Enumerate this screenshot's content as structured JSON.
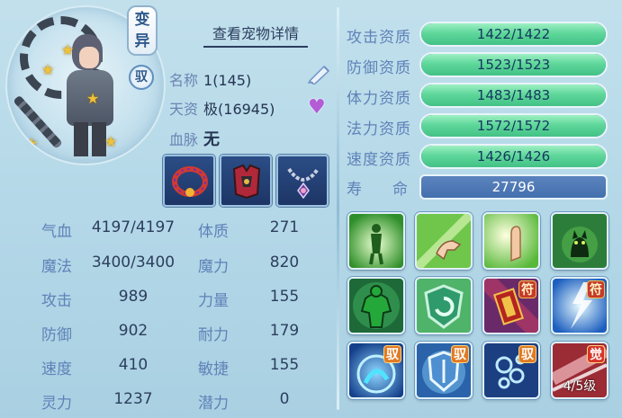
{
  "header": {
    "transform_badge": "变异",
    "ride_badge": "驭",
    "detail_link": "查看宠物详情"
  },
  "info": {
    "name_label": "名称",
    "name_value": "1(145)",
    "talent_label": "天资",
    "talent_value": "极(16945)",
    "blood_label": "血脉",
    "blood_value": "无"
  },
  "equipment": [
    {
      "name": "collar",
      "accent": "#d23a30"
    },
    {
      "name": "armor",
      "accent": "#b0283a"
    },
    {
      "name": "necklace",
      "accent": "#6b3fa3"
    }
  ],
  "stats": [
    {
      "label": "气血",
      "value": "4197/4197"
    },
    {
      "label": "魔法",
      "value": "3400/3400"
    },
    {
      "label": "攻击",
      "value": "989"
    },
    {
      "label": "防御",
      "value": "902"
    },
    {
      "label": "速度",
      "value": "410"
    },
    {
      "label": "灵力",
      "value": "1237"
    }
  ],
  "attributes": [
    {
      "label": "体质",
      "value": "271"
    },
    {
      "label": "魔力",
      "value": "820"
    },
    {
      "label": "力量",
      "value": "155"
    },
    {
      "label": "耐力",
      "value": "179"
    },
    {
      "label": "敏捷",
      "value": "155"
    },
    {
      "label": "潜力",
      "value": "0"
    }
  ],
  "aptitudes": [
    {
      "label": "攻击资质",
      "value": "1422/1422",
      "fill": 1.0
    },
    {
      "label": "防御资质",
      "value": "1523/1523",
      "fill": 1.0
    },
    {
      "label": "体力资质",
      "value": "1483/1483",
      "fill": 1.0
    },
    {
      "label": "法力资质",
      "value": "1572/1572",
      "fill": 1.0
    },
    {
      "label": "速度资质",
      "value": "1426/1426",
      "fill": 1.0
    }
  ],
  "lifespan": {
    "label_a": "寿",
    "label_b": "命",
    "value": "27796"
  },
  "skills": [
    {
      "name": "skill-figure-icon",
      "tag": "",
      "level": ""
    },
    {
      "name": "skill-strike-hand-icon",
      "tag": "",
      "level": ""
    },
    {
      "name": "skill-palm-icon",
      "tag": "",
      "level": ""
    },
    {
      "name": "skill-cat-icon",
      "tag": "",
      "level": ""
    },
    {
      "name": "skill-muscle-icon",
      "tag": "",
      "level": ""
    },
    {
      "name": "skill-shield-icon",
      "tag": "",
      "level": ""
    },
    {
      "name": "skill-talisman-scroll-icon",
      "tag": "符",
      "level": ""
    },
    {
      "name": "skill-lightning-icon",
      "tag": "符",
      "level": ""
    },
    {
      "name": "skill-water-rider-icon",
      "tag": "驭",
      "level": ""
    },
    {
      "name": "skill-guard-shield-icon",
      "tag": "驭",
      "level": ""
    },
    {
      "name": "skill-bubbles-icon",
      "tag": "驭",
      "level": ""
    },
    {
      "name": "skill-awaken-icon",
      "tag": "觉",
      "level": "4/5级"
    }
  ]
}
